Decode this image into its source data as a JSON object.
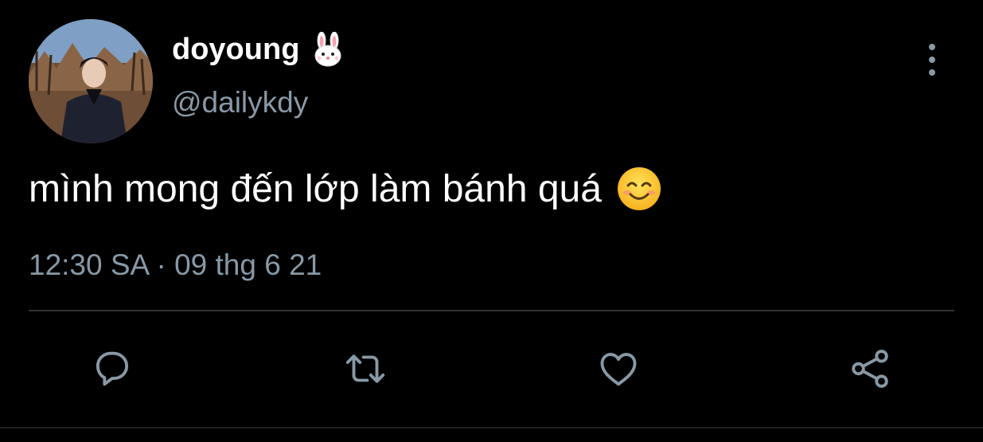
{
  "author": {
    "display_name": "doyoung",
    "name_emoji": "rabbit-face-emoji",
    "handle": "@dailykdy",
    "avatar": "profile-photo-person-in-dark-coat-autumn-trees"
  },
  "tweet": {
    "text": "mình mong đến lớp làm bánh quá",
    "text_emoji": "smiling-face-with-smiling-eyes-emoji",
    "timestamp": "12:30 SA · 09 thg 6 21"
  },
  "menu": {
    "icon": "more-vertical-icon"
  },
  "actions": [
    {
      "name": "reply",
      "icon": "reply-icon"
    },
    {
      "name": "retweet",
      "icon": "retweet-icon"
    },
    {
      "name": "like",
      "icon": "heart-icon"
    },
    {
      "name": "share",
      "icon": "share-icon"
    }
  ],
  "colors": {
    "background": "#000000",
    "text": "#ffffff",
    "secondary": "#8899a6",
    "divider": "#2f3336"
  }
}
